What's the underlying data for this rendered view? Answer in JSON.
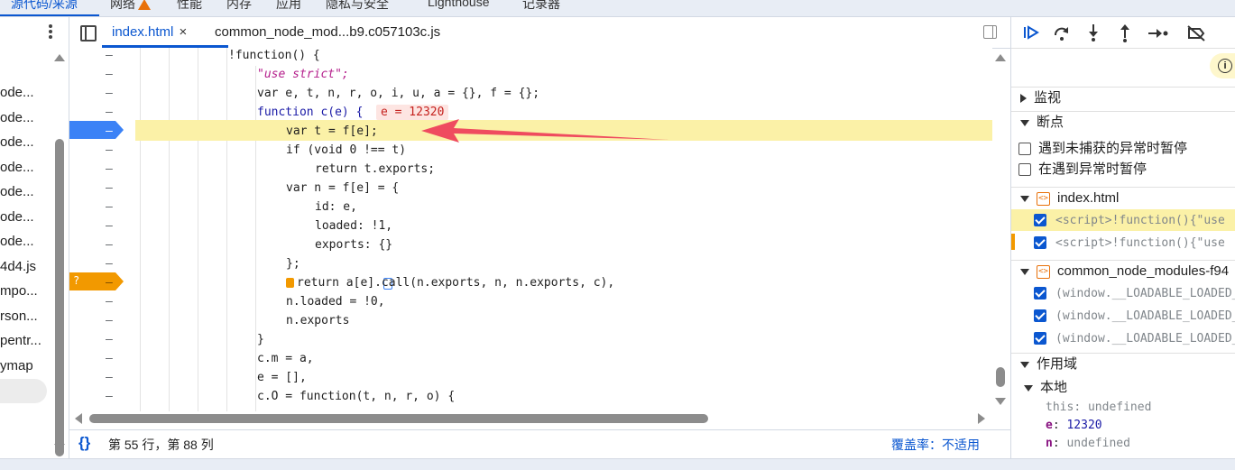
{
  "top_tabs": [
    {
      "label": "源代码/来源",
      "active": true
    },
    {
      "label": "网络",
      "warning": true
    },
    {
      "label": "性能"
    },
    {
      "label": "内存"
    },
    {
      "label": "应用"
    },
    {
      "label": "隐私与安全"
    },
    {
      "label": "Lighthouse"
    },
    {
      "label": "记录器"
    }
  ],
  "file_tree": {
    "items": [
      "ode...",
      "ode...",
      "ode...",
      "ode...",
      "ode...",
      "ode...",
      "ode...",
      "4d4.js",
      "mpo...",
      "rson...",
      "pentr...",
      "ymap"
    ]
  },
  "editor_tabs": [
    {
      "label": "index.html",
      "active": true,
      "close": "×"
    },
    {
      "label": "common_node_mod...b9.c057103c.js"
    }
  ],
  "code": {
    "line_marker": "–",
    "breakpoint_marker": "–",
    "conditional_marker": "?",
    "lines": [
      "!function() {",
      "\"use strict\";",
      "var e, t, n, r, o, i, u, a = {}, f = {};",
      "function c(e) {",
      "var t = f[e];",
      "if (void 0 !== t)",
      "return t.exports;",
      "var n = f[e] = {",
      "id: e,",
      "loaded: !1,",
      "exports: {}",
      "};",
      "return a[e].call(n.exports, n, n.exports, c),",
      "n.loaded = !0,",
      "n.exports",
      "}",
      "c.m = a,",
      "e = [],",
      "c.O = function(t, n, r, o) {"
    ],
    "inline_value": "e = 12320"
  },
  "status_bar": {
    "braces": "{}",
    "position": "第 55 行，第 88 列",
    "coverage": "覆盖率：不适用"
  },
  "right_panel": {
    "watch": "监视",
    "breakpoints": "断点",
    "pause_uncaught": "遇到未捕获的异常时暂停",
    "pause_caught": "在遇到异常时暂停",
    "bp_groups": [
      {
        "file": "index.html",
        "items": [
          "<script>!function(){\"use",
          "<script>!function(){\"use"
        ]
      },
      {
        "file": "common_node_modules-f94",
        "items": [
          "(window.__LOADABLE_LOADED_",
          "(window.__LOADABLE_LOADED_",
          "(window.__LOADABLE_LOADED_"
        ]
      }
    ],
    "scope": "作用域",
    "local": "本地",
    "scope_vars": [
      {
        "name": "this",
        "value": "undefined"
      },
      {
        "name": "e",
        "value": "12320"
      },
      {
        "name": "n",
        "value": "undefined"
      }
    ],
    "info_glyph": "i"
  },
  "colors": {
    "accent": "#0b57d0",
    "highlight_line": "#fbf1a7",
    "breakpoint": "#3b82f6",
    "conditional_breakpoint": "#f29900",
    "annotation_arrow": "#ef4b5f"
  }
}
